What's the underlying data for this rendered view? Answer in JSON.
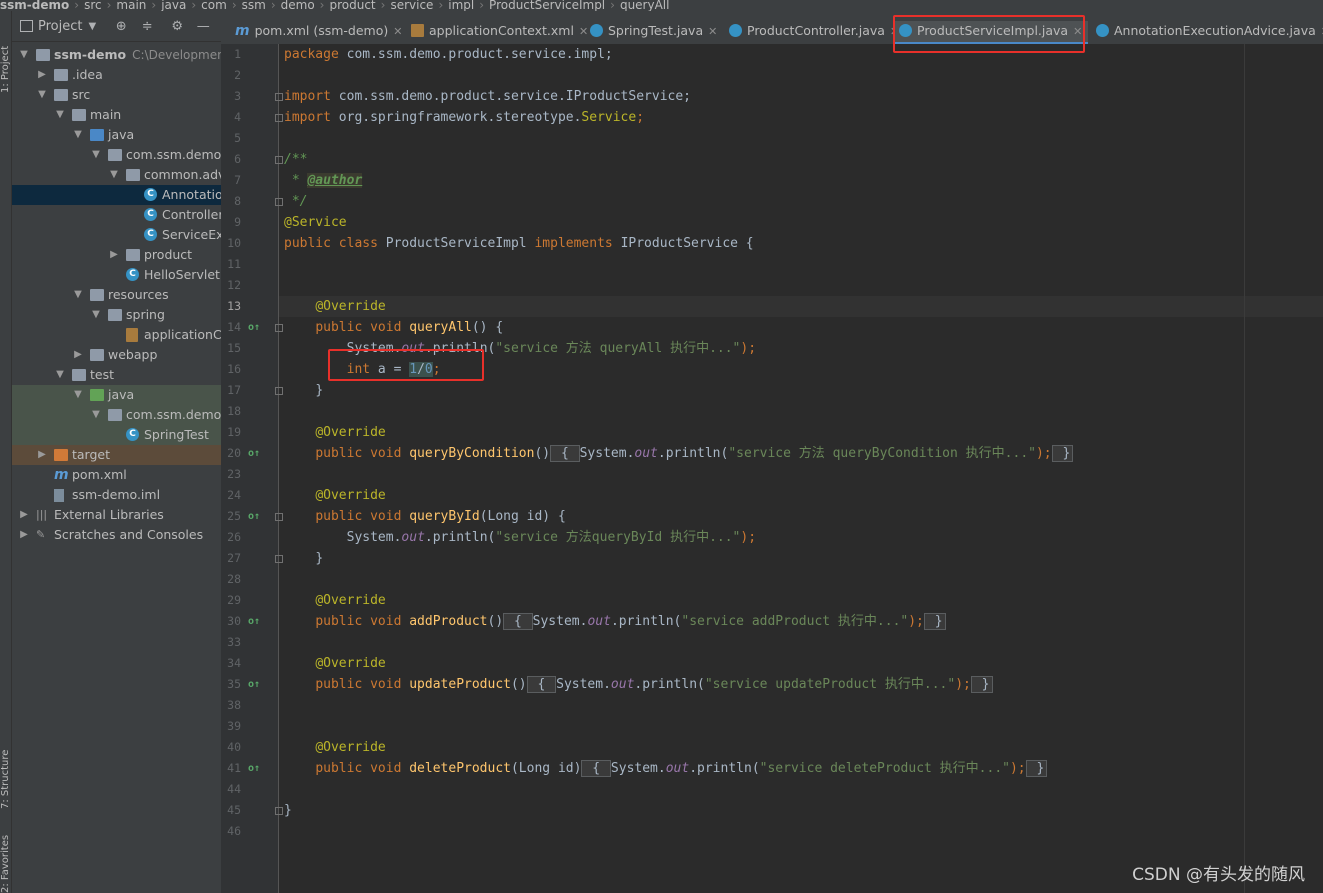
{
  "breadcrumb": [
    "ssm-demo",
    "src",
    "main",
    "java",
    "com",
    "ssm",
    "demo",
    "product",
    "service",
    "impl",
    "ProductServiceImpl",
    "queryAll"
  ],
  "tool_stripe": {
    "project": "1: Project",
    "structure": "7: Structure",
    "favorites": "2: Favorites"
  },
  "project_panel": {
    "title": "Project",
    "tree": [
      {
        "label": "ssm-demo",
        "path": "C:\\Development\\",
        "depth": 0,
        "arrow": "down",
        "icon": "folder"
      },
      {
        "label": ".idea",
        "depth": 1,
        "arrow": "right",
        "icon": "folder"
      },
      {
        "label": "src",
        "depth": 1,
        "arrow": "down",
        "icon": "folder"
      },
      {
        "label": "main",
        "depth": 2,
        "arrow": "down",
        "icon": "folder"
      },
      {
        "label": "java",
        "depth": 3,
        "arrow": "down",
        "icon": "folder-blue"
      },
      {
        "label": "com.ssm.demo",
        "depth": 4,
        "arrow": "down",
        "icon": "package"
      },
      {
        "label": "common.adv",
        "depth": 5,
        "arrow": "down",
        "icon": "package"
      },
      {
        "label": "Annotation",
        "depth": 6,
        "icon": "class",
        "selected": true
      },
      {
        "label": "Controller",
        "depth": 6,
        "icon": "class"
      },
      {
        "label": "ServiceExe",
        "depth": 6,
        "icon": "class"
      },
      {
        "label": "product",
        "depth": 5,
        "arrow": "right",
        "icon": "package"
      },
      {
        "label": "HelloServlet",
        "depth": 5,
        "icon": "class"
      },
      {
        "label": "resources",
        "depth": 3,
        "arrow": "down",
        "icon": "resources"
      },
      {
        "label": "spring",
        "depth": 4,
        "arrow": "down",
        "icon": "folder"
      },
      {
        "label": "applicationCo",
        "depth": 5,
        "icon": "xml"
      },
      {
        "label": "webapp",
        "depth": 3,
        "arrow": "right",
        "icon": "folder"
      },
      {
        "label": "test",
        "depth": 2,
        "arrow": "down",
        "icon": "folder"
      },
      {
        "label": "java",
        "depth": 3,
        "arrow": "down",
        "icon": "folder-green",
        "test": true
      },
      {
        "label": "com.ssm.demo",
        "depth": 4,
        "arrow": "down",
        "icon": "package",
        "test": true
      },
      {
        "label": "SpringTest",
        "depth": 5,
        "icon": "class",
        "test": true
      },
      {
        "label": "target",
        "depth": 1,
        "arrow": "right",
        "icon": "folder-orange",
        "target": true
      },
      {
        "label": "pom.xml",
        "depth": 1,
        "icon": "maven"
      },
      {
        "label": "ssm-demo.iml",
        "depth": 1,
        "icon": "iml"
      },
      {
        "label": "External Libraries",
        "depth": 0,
        "arrow": "right",
        "icon": "library"
      },
      {
        "label": "Scratches and Consoles",
        "depth": 0,
        "arrow": "right",
        "icon": "scratch"
      }
    ]
  },
  "tabs": [
    {
      "label": "pom.xml (ssm-demo)",
      "icon": "maven"
    },
    {
      "label": "applicationContext.xml",
      "icon": "xml"
    },
    {
      "label": "SpringTest.java",
      "icon": "class"
    },
    {
      "label": "ProductController.java",
      "icon": "class"
    },
    {
      "label": "ProductServiceImpl.java",
      "icon": "class",
      "active": true
    },
    {
      "label": "AnnotationExecutionAdvice.java",
      "icon": "class"
    }
  ],
  "editor": {
    "line_numbers": [
      "1",
      "2",
      "3",
      "4",
      "5",
      "6",
      "7",
      "8",
      "9",
      "10",
      "11",
      "12",
      "13",
      "14",
      "15",
      "16",
      "17",
      "18",
      "19",
      "20",
      "23",
      "24",
      "25",
      "26",
      "27",
      "28",
      "29",
      "30",
      "33",
      "34",
      "35",
      "38",
      "39",
      "40",
      "41",
      "44",
      "45",
      "46"
    ],
    "current_line": "13",
    "code": {
      "l1": [
        "package",
        " com.ssm.demo.product.service.impl;"
      ],
      "l3": [
        "import",
        " com.ssm.demo.product.service.IProductService;"
      ],
      "l4": [
        "import",
        " org.springframework.stereotype.",
        "Service",
        ";"
      ],
      "l6": "/**",
      "l7": [
        " * ",
        "@author"
      ],
      "l8": " */",
      "l9": "@Service",
      "l10": [
        "public class",
        " ProductServiceImpl ",
        "implements",
        " IProductService {"
      ],
      "l13": "@Override",
      "l14": [
        "public void",
        " ",
        "queryAll",
        "() {"
      ],
      "l15": [
        "System.",
        "out",
        ".println(",
        "\"service 方法 queryAll 执行中...\"",
        ");"
      ],
      "l16": [
        "int",
        " a = ",
        "1",
        "/",
        "0",
        ";"
      ],
      "l17": "}",
      "l19": "@Override",
      "l20": [
        "public void",
        " ",
        "queryByCondition",
        "()",
        " { ",
        "System.",
        "out",
        ".println(",
        "\"service 方法 queryByCondition 执行中...\"",
        ");",
        " }"
      ],
      "l24": "@Override",
      "l25": [
        "public void",
        " ",
        "queryById",
        "(Long id) {"
      ],
      "l26": [
        "System.",
        "out",
        ".println(",
        "\"service 方法queryById 执行中...\"",
        ");"
      ],
      "l27": "}",
      "l29": "@Override",
      "l30": [
        "public void",
        " ",
        "addProduct",
        "()",
        " { ",
        "System.",
        "out",
        ".println(",
        "\"service addProduct 执行中...\"",
        ");",
        " }"
      ],
      "l34": "@Override",
      "l35": [
        "public void",
        " ",
        "updateProduct",
        "()",
        " { ",
        "System.",
        "out",
        ".println(",
        "\"service updateProduct 执行中...\"",
        ");",
        " }"
      ],
      "l40": "@Override",
      "l41": [
        "public void",
        " ",
        "deleteProduct",
        "(Long id)",
        " { ",
        "System.",
        "out",
        ".println(",
        "\"service deleteProduct 执行中...\"",
        ");",
        " }"
      ],
      "l45": "}"
    }
  },
  "watermark": "CSDN @有头发的随风",
  "colors": {
    "keyword": "#cc7832",
    "annotation": "#bbb529",
    "string": "#6a8759",
    "method": "#ffc66d",
    "static_field": "#9876aa",
    "number": "#6897bb",
    "highlight_box": "#e8302a"
  }
}
